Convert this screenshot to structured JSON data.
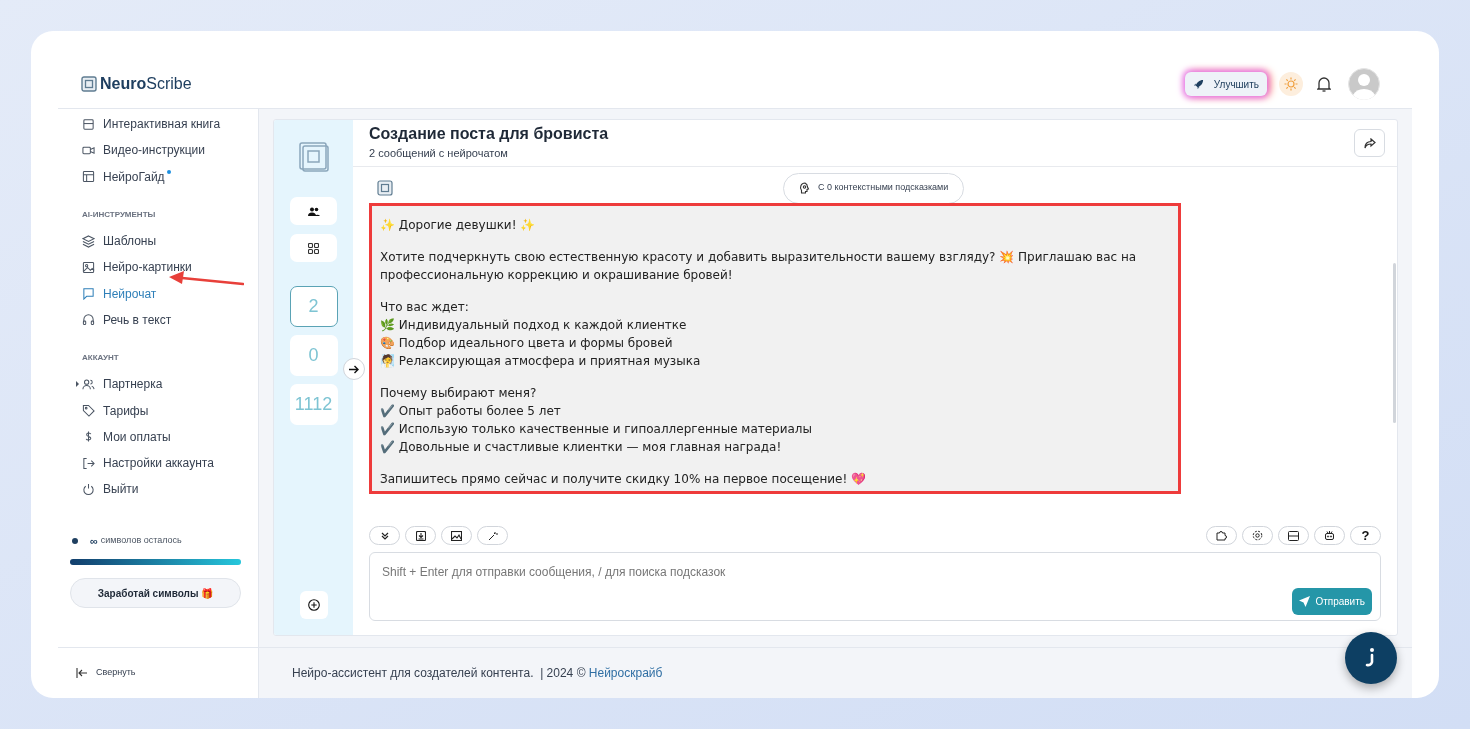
{
  "brand": {
    "bold": "Neuro",
    "rest": "Scribe"
  },
  "header": {
    "upgrade": "Улучшить"
  },
  "sidebar": {
    "sections": [
      {
        "items": [
          {
            "label": "Интерактивная книга",
            "selected": false
          },
          {
            "label": "Видео-инструкции",
            "selected": false
          },
          {
            "label": "НейроГайд",
            "selected": false,
            "badge": true
          }
        ]
      },
      {
        "heading": "AI-ИНСТРУМЕНТЫ",
        "items": [
          {
            "label": "Шаблоны",
            "selected": false
          },
          {
            "label": "Нейро-картинки",
            "selected": false
          },
          {
            "label": "Нейрочат",
            "selected": true
          },
          {
            "label": "Речь в текст",
            "selected": false
          }
        ]
      },
      {
        "heading": "АККАУНТ",
        "items": [
          {
            "label": "Партнерка",
            "selected": false,
            "expanded": false
          },
          {
            "label": "Тарифы",
            "selected": false
          },
          {
            "label": "Мои оплаты",
            "selected": false
          },
          {
            "label": "Настройки аккаунта",
            "selected": false
          },
          {
            "label": "Выйти",
            "selected": false
          }
        ]
      }
    ],
    "symbols": {
      "count": "∞",
      "label": "символов осталось",
      "level": 1
    },
    "earn_button": "Заработай символы 🎁",
    "collapse": "Свернуть"
  },
  "chat": {
    "title": "Создание поста для бровиста",
    "subtitle": "2 сообщений с нейрочатом",
    "counters": [
      {
        "value": "2",
        "selected": true
      },
      {
        "value": "0",
        "selected": false
      },
      {
        "value": "1112",
        "selected": false
      }
    ],
    "context_button": "С 0 контекстными подсказками",
    "message": [
      [
        "✨ Дорогие девушки! ✨"
      ],
      [
        "Хотите подчеркнуть свою естественную красоту и добавить выразительности вашему взгляду? 💥 Приглашаю вас на",
        "профессиональную коррекцию и окрашивание бровей!"
      ],
      [
        "Что вас ждет:",
        "🌿 Индивидуальный подход к каждой клиентке",
        "🎨 Подбор идеального цвета и формы бровей",
        "🧖 Релаксирующая атмосфера и приятная музыка"
      ],
      [
        "Почему выбирают меня?",
        "✔️ Опыт работы более 5 лет",
        "✔️ Использую только качественные и гипоаллергенные материалы",
        "✔️ Довольные и счастливые клиентки — моя главная награда!"
      ],
      [
        "Запишитесь прямо сейчас и получите скидку 10% на первое посещение! 💖"
      ]
    ],
    "help": "?",
    "placeholder": "Shift + Enter для отправки сообщения, / для поиска подсказок",
    "send": "Отправить"
  },
  "footer": {
    "text": "Нейро-ассистент для создателей контента.  | 2024 © ",
    "link": "Нейроскрайб"
  }
}
